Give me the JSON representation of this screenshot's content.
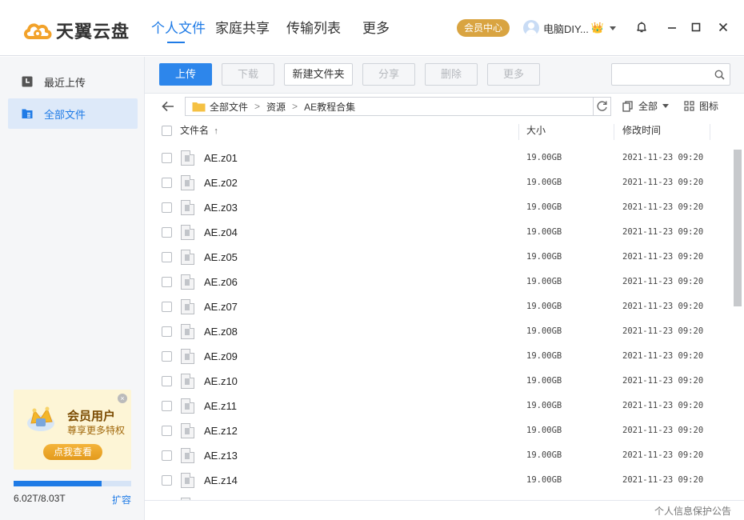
{
  "app": {
    "logo_text": "天翼云盘",
    "colors": {
      "accent": "#1f7be6",
      "vip_gold": "#d9a441"
    }
  },
  "nav": {
    "items": [
      {
        "label": "个人文件",
        "active": true
      },
      {
        "label": "家庭共享",
        "active": false
      },
      {
        "label": "传输列表",
        "active": false
      },
      {
        "label": "更多",
        "active": false
      }
    ]
  },
  "header": {
    "vip_center_label": "会员中心",
    "user_name": "电脑DIY...",
    "crown_glyph": "👑"
  },
  "sidebar": {
    "items": [
      {
        "label": "最近上传",
        "icon": "clock-icon",
        "active": false
      },
      {
        "label": "全部文件",
        "icon": "folder-list-icon",
        "active": true
      }
    ],
    "vip_card": {
      "title": "会员用户",
      "subtitle": "尊享更多特权",
      "cta": "点我查看",
      "close_glyph": "×"
    },
    "storage": {
      "used_total": "6.02T/8.03T",
      "used_fraction": 0.75,
      "expand_label": "扩容"
    }
  },
  "toolbar": {
    "upload": "上传",
    "download": "下载",
    "new_folder": "新建文件夹",
    "share": "分享",
    "delete": "删除",
    "more": "更多",
    "search_placeholder": ""
  },
  "path": {
    "crumbs": [
      "全部文件",
      "资源",
      "AE教程合集"
    ],
    "separator": ">"
  },
  "filter": {
    "label": "全部",
    "view_label": "图标"
  },
  "table": {
    "headers": {
      "name": "文件名",
      "sort_glyph": "↑",
      "size": "大小",
      "modified": "修改时间"
    },
    "rows": [
      {
        "name": "AE.z01",
        "size": "19.00GB",
        "modified": "2021-11-23 09:20"
      },
      {
        "name": "AE.z02",
        "size": "19.00GB",
        "modified": "2021-11-23 09:20"
      },
      {
        "name": "AE.z03",
        "size": "19.00GB",
        "modified": "2021-11-23 09:20"
      },
      {
        "name": "AE.z04",
        "size": "19.00GB",
        "modified": "2021-11-23 09:20"
      },
      {
        "name": "AE.z05",
        "size": "19.00GB",
        "modified": "2021-11-23 09:20"
      },
      {
        "name": "AE.z06",
        "size": "19.00GB",
        "modified": "2021-11-23 09:20"
      },
      {
        "name": "AE.z07",
        "size": "19.00GB",
        "modified": "2021-11-23 09:20"
      },
      {
        "name": "AE.z08",
        "size": "19.00GB",
        "modified": "2021-11-23 09:20"
      },
      {
        "name": "AE.z09",
        "size": "19.00GB",
        "modified": "2021-11-23 09:20"
      },
      {
        "name": "AE.z10",
        "size": "19.00GB",
        "modified": "2021-11-23 09:20"
      },
      {
        "name": "AE.z11",
        "size": "19.00GB",
        "modified": "2021-11-23 09:20"
      },
      {
        "name": "AE.z12",
        "size": "19.00GB",
        "modified": "2021-11-23 09:20"
      },
      {
        "name": "AE.z13",
        "size": "19.00GB",
        "modified": "2021-11-23 09:20"
      },
      {
        "name": "AE.z14",
        "size": "19.00GB",
        "modified": "2021-11-23 09:20"
      }
    ]
  },
  "footer": {
    "privacy_notice": "个人信息保护公告"
  }
}
